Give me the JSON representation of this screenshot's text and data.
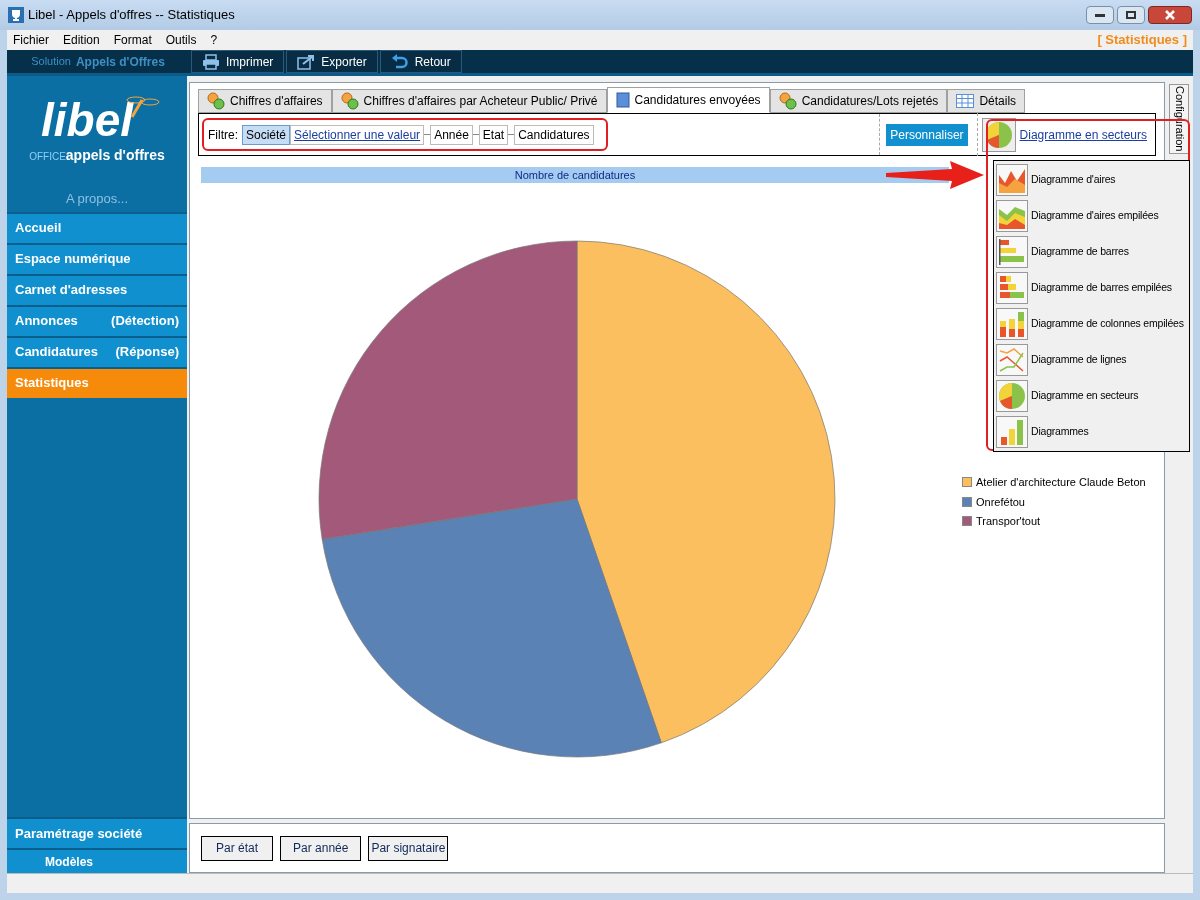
{
  "window": {
    "title": "Libel - Appels d'offres -- Statistiques"
  },
  "menu": [
    "Fichier",
    "Edition",
    "Format",
    "Outils",
    "?"
  ],
  "section_label": "[ Statistiques ]",
  "toolbar": {
    "solution_label": "Solution",
    "solution_name": "Appels d'Offres",
    "buttons": [
      "Imprimer",
      "Exporter",
      "Retour"
    ]
  },
  "sidebar": {
    "logo_text": "libel",
    "logo_office": "OFFICE",
    "logo_subtitle": "appels d'offres",
    "about": "A propos...",
    "items": [
      {
        "label": "Accueil",
        "selected": false
      },
      {
        "label": "Espace numérique",
        "selected": false
      },
      {
        "label": "Carnet d'adresses",
        "selected": false
      },
      {
        "label": "Annonces",
        "note": "(Détection)",
        "selected": false
      },
      {
        "label": "Candidatures",
        "note": "(Réponse)",
        "selected": false
      },
      {
        "label": "Statistiques",
        "selected": true
      }
    ],
    "bottom_items": [
      "Paramétrage société",
      "Modèles"
    ]
  },
  "tabs": [
    {
      "label": "Chiffres d'affaires",
      "selected": false
    },
    {
      "label": "Chiffres d'affaires par Acheteur Public/ Privé",
      "selected": false
    },
    {
      "label": "Candidatures envoyées",
      "selected": true
    },
    {
      "label": "Candidatures/Lots rejetés",
      "selected": false
    },
    {
      "label": "Détails",
      "selected": false
    }
  ],
  "filter": {
    "label": "Filtre:",
    "chips": [
      {
        "label": "Société",
        "kind": "field",
        "selected": true
      },
      {
        "label": "Sélectionner une valeur",
        "kind": "link"
      },
      {
        "label": "Année",
        "kind": "field",
        "selected": false
      },
      {
        "label": "Etat",
        "kind": "field",
        "selected": false
      },
      {
        "label": "Candidatures",
        "kind": "field",
        "selected": false
      }
    ]
  },
  "customize_button": "Personnaliser",
  "chart_type": "Diagramme en secteurs",
  "chart_menu": [
    "Diagramme d'aires",
    "Diagramme d'aires empilées",
    "Diagramme de barres",
    "Diagramme de barres empilées",
    "Diagramme de colonnes empilées",
    "Diagramme de lignes",
    "Diagramme en secteurs",
    "Diagrammes"
  ],
  "chart": {
    "title": "Nombre de candidatures",
    "legend": [
      {
        "label": "Atelier d'architecture Claude Beton",
        "color": "#fcbf5f"
      },
      {
        "label": "Onrefétou",
        "color": "#5b82b4"
      },
      {
        "label": "Transpor'tout",
        "color": "#a35a7a"
      }
    ]
  },
  "bottom_buttons": [
    "Par état",
    "Par année",
    "Par signataire"
  ],
  "side_tab": "Configuration"
}
